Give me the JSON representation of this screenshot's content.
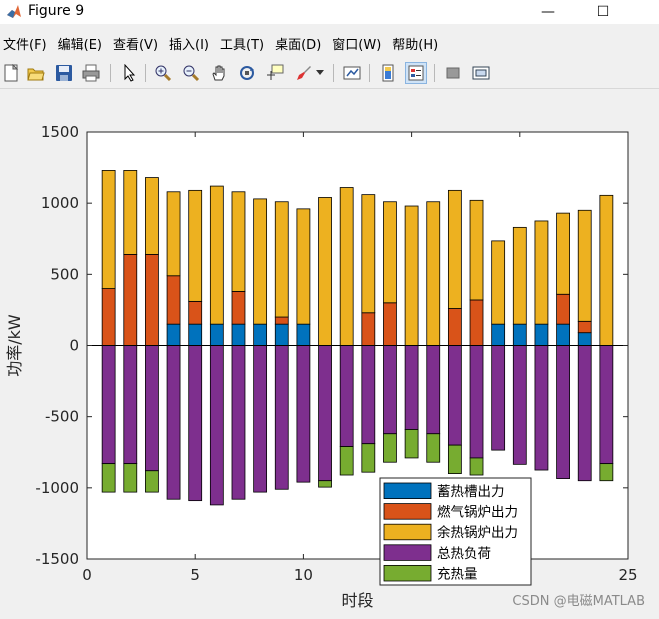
{
  "window": {
    "title": "Figure 9",
    "minimize_glyph": "—",
    "maximize_glyph": "☐"
  },
  "menu": [
    {
      "label": "文件(F)",
      "name": "menu-file"
    },
    {
      "label": "编辑(E)",
      "name": "menu-edit"
    },
    {
      "label": "查看(V)",
      "name": "menu-view"
    },
    {
      "label": "插入(I)",
      "name": "menu-insert"
    },
    {
      "label": "工具(T)",
      "name": "menu-tools"
    },
    {
      "label": "桌面(D)",
      "name": "menu-desktop"
    },
    {
      "label": "窗口(W)",
      "name": "menu-window"
    },
    {
      "label": "帮助(H)",
      "name": "menu-help"
    }
  ],
  "toolbar_icons": [
    "new-file-icon",
    "open-folder-icon",
    "save-icon",
    "print-icon",
    "pointer-icon",
    "zoom-in-icon",
    "zoom-out-icon",
    "pan-hand-icon",
    "rotate-3d-icon",
    "data-cursor-icon",
    "brush-icon",
    "dropdown-arrow-icon",
    "link-plot-icon",
    "colorbar-icon",
    "legend-icon",
    "hide-plot-tools-icon",
    "show-plot-tools-icon"
  ],
  "colors": {
    "storage": "#0072BD",
    "boiler": "#D95319",
    "waste": "#EDB120",
    "load": "#7E2F8E",
    "charge": "#77AC30"
  },
  "chart_data": {
    "type": "bar",
    "stacked": true,
    "xlabel": "时段",
    "ylabel": "功率/kW",
    "xlim": [
      0,
      25
    ],
    "ylim": [
      -1500,
      1500
    ],
    "xticks": [
      0,
      5,
      10,
      15,
      20,
      25
    ],
    "yticks": [
      -1500,
      -1000,
      -500,
      0,
      500,
      1000,
      1500
    ],
    "grid": false,
    "legend_position": "bottom-center",
    "x": [
      1,
      2,
      3,
      4,
      5,
      6,
      7,
      8,
      9,
      10,
      11,
      12,
      13,
      14,
      15,
      16,
      17,
      18,
      19,
      20,
      21,
      22,
      23,
      24
    ],
    "series": [
      {
        "name": "蓄热槽出力",
        "color": "#0072BD",
        "values": [
          0,
          0,
          0,
          150,
          150,
          150,
          150,
          150,
          150,
          150,
          0,
          0,
          0,
          0,
          0,
          0,
          0,
          0,
          150,
          150,
          150,
          150,
          90,
          0
        ]
      },
      {
        "name": "燃气锅炉出力",
        "color": "#D95319",
        "values": [
          400,
          640,
          640,
          340,
          160,
          0,
          230,
          0,
          50,
          0,
          0,
          0,
          230,
          300,
          0,
          0,
          260,
          320,
          0,
          0,
          0,
          210,
          80,
          0
        ]
      },
      {
        "name": "余热锅炉出力",
        "color": "#EDB120",
        "values": [
          830,
          590,
          540,
          590,
          780,
          970,
          700,
          880,
          810,
          810,
          1040,
          1110,
          830,
          710,
          980,
          1010,
          830,
          700,
          585,
          680,
          725,
          570,
          780,
          1055
        ]
      },
      {
        "name": "总热负荷",
        "color": "#7E2F8E",
        "values": [
          -830,
          -830,
          -880,
          -1080,
          -1090,
          -1120,
          -1080,
          -1030,
          -1010,
          -960,
          -950,
          -710,
          -690,
          -620,
          -590,
          -620,
          -700,
          -790,
          -735,
          -835,
          -875,
          -935,
          -950,
          -830
        ]
      },
      {
        "name": "充热量",
        "color": "#77AC30",
        "values": [
          -200,
          -200,
          -150,
          0,
          0,
          0,
          0,
          0,
          0,
          0,
          -45,
          -200,
          -200,
          -200,
          -200,
          -200,
          -200,
          -120,
          0,
          0,
          0,
          0,
          0,
          -120
        ]
      }
    ]
  },
  "watermark": "CSDN @电磁MATLAB"
}
